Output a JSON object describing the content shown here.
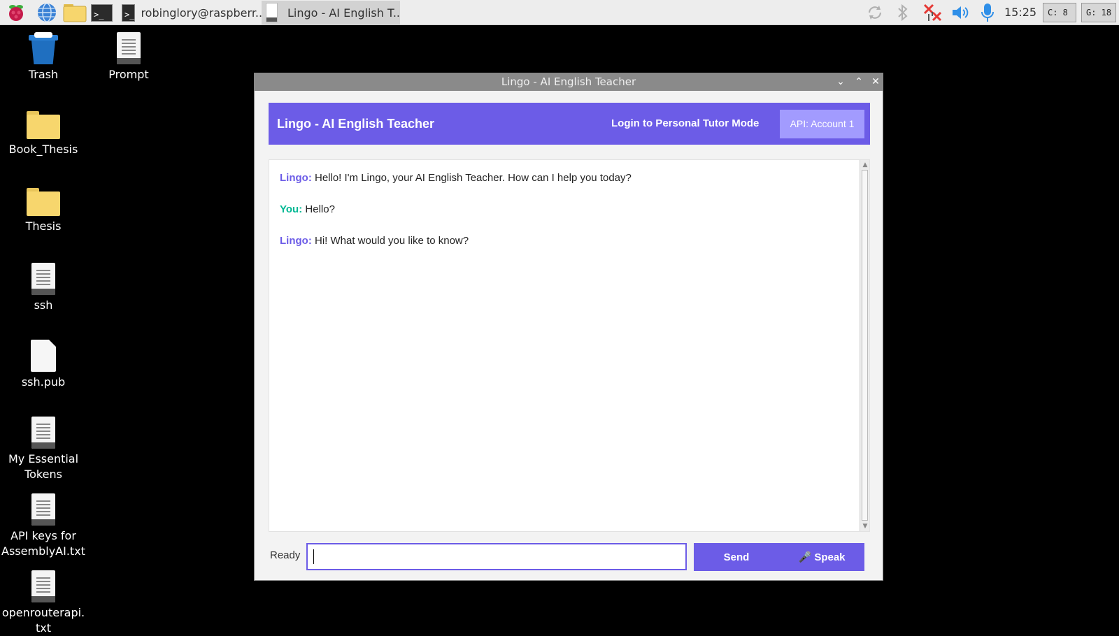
{
  "taskbar": {
    "menu_icon": "raspberry-pi-icon",
    "browser_icon": "globe-icon",
    "files_icon": "folder-icon",
    "terminal_icon": "terminal-icon",
    "terminal_glyph": ">_",
    "tasks": [
      {
        "label": "robinglory@raspberr..",
        "icon": "terminal-icon"
      },
      {
        "label": "Lingo - AI English T..",
        "icon": "document-icon"
      }
    ],
    "tray_icons": [
      "sync-icon",
      "bluetooth-icon",
      "network-disconnected-icon",
      "volume-icon",
      "microphone-icon"
    ],
    "clock": "15:25",
    "cpu_monitor": "C: 8",
    "gpu_monitor": "G: 18"
  },
  "desktop": {
    "icons": [
      {
        "label": "Trash",
        "icon": "trash-icon"
      },
      {
        "label": "Prompt",
        "icon": "text-file-icon"
      },
      {
        "label": "Book_Thesis",
        "icon": "folder-icon"
      },
      {
        "label": "Thesis",
        "icon": "folder-icon"
      },
      {
        "label": "ssh",
        "icon": "text-file-icon"
      },
      {
        "label": "ssh.pub",
        "icon": "file-icon"
      },
      {
        "label": "My Essential Tokens",
        "icon": "text-file-icon"
      },
      {
        "label": "API keys for AssemblyAI.txt",
        "icon": "text-file-icon"
      },
      {
        "label": "openrouterapi.\ntxt",
        "icon": "text-file-icon"
      }
    ]
  },
  "window": {
    "title": "Lingo - AI English Teacher",
    "controls": {
      "minimize": "⌄",
      "maximize": "⌃",
      "close": "✕"
    },
    "header": {
      "title": "Lingo - AI English Teacher",
      "login_label": "Login to Personal Tutor Mode",
      "api_label": "API: Account 1"
    },
    "messages": [
      {
        "speaker": "Lingo:",
        "text": "Hello! I'm Lingo, your AI English Teacher. How can I help you today?"
      },
      {
        "speaker": "You:",
        "text": "Hello?"
      },
      {
        "speaker": "Lingo:",
        "text": "Hi! What would you like to know?"
      }
    ],
    "status": "Ready",
    "input": {
      "value": "",
      "placeholder": ""
    },
    "send_label": "Send",
    "speak_label": "🎤 Speak"
  },
  "colors": {
    "accent": "#6c5ce7",
    "api_button": "#a29bfe",
    "user_name": "#00b894"
  }
}
